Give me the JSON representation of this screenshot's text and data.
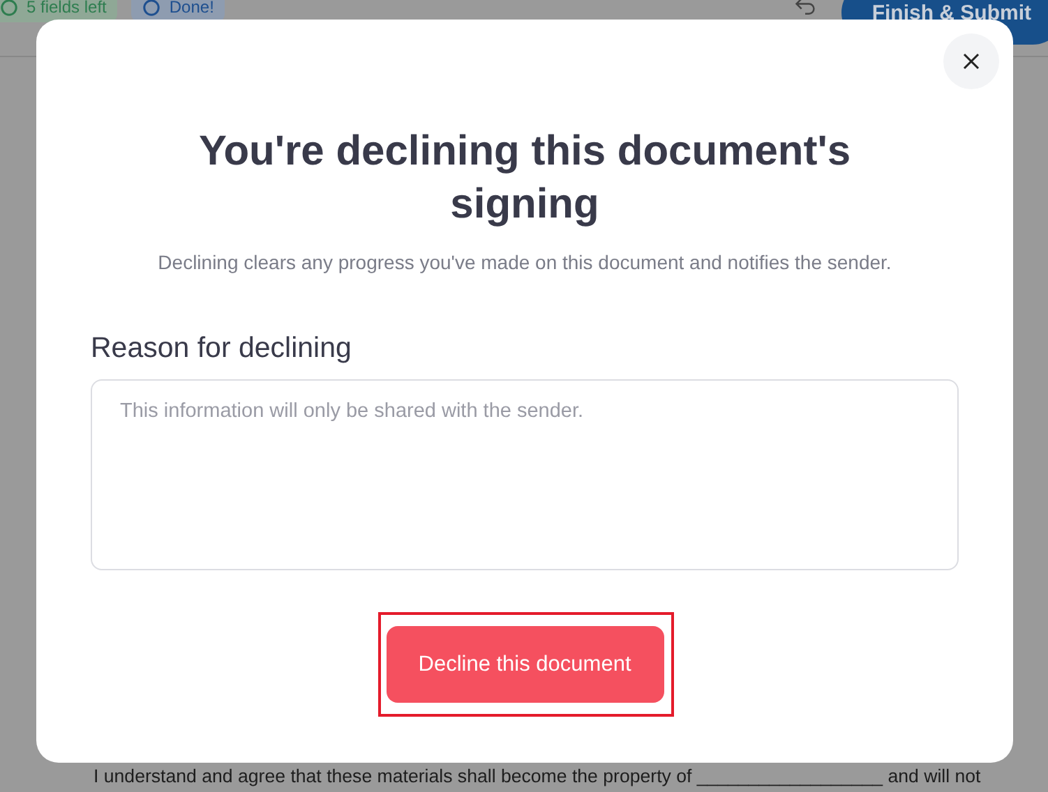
{
  "toolbar": {
    "fields_left": "5 fields left",
    "done": "Done!",
    "submit": "Finish & Submit"
  },
  "document": {
    "text": "I understand and agree that these materials shall become the property of __________________ and will not"
  },
  "dialog": {
    "title": "You're declining this document's signing",
    "subtitle": "Declining clears any progress you've made on this document and notifies the sender.",
    "reason_label": "Reason for declining",
    "reason_field": {
      "placeholder": "This information will only be shared with the sender."
    },
    "decline_button": "Decline this document",
    "button_highlighted": true
  }
}
